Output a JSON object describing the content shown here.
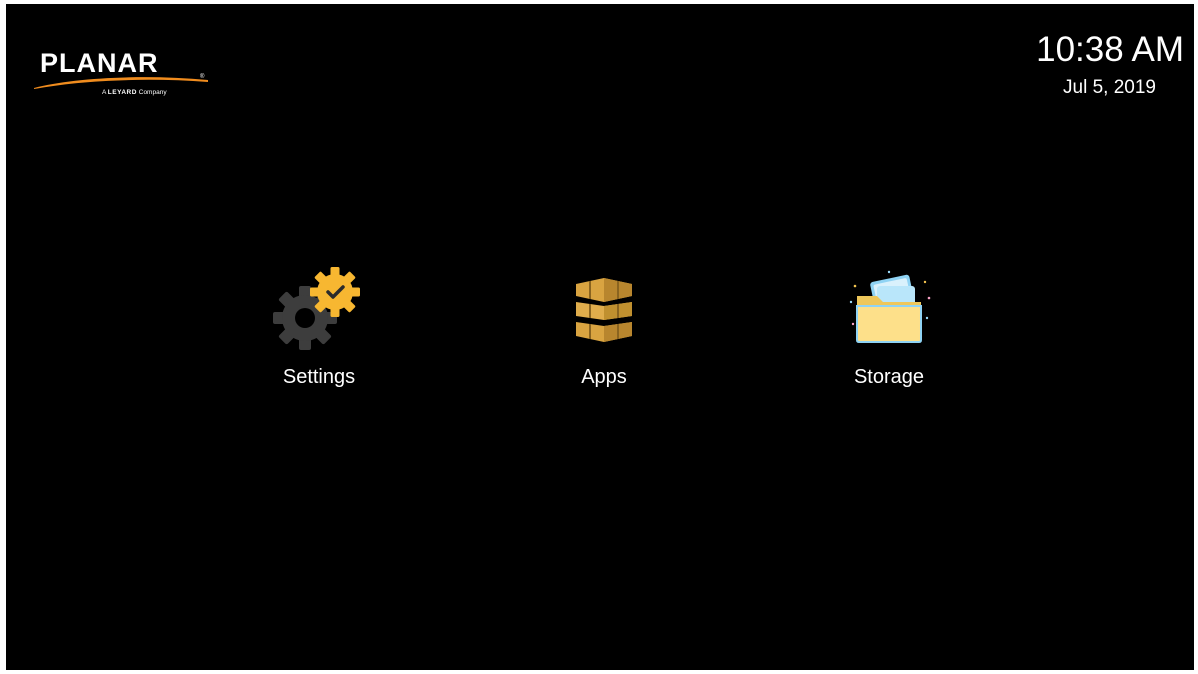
{
  "brand": {
    "name": "PLANAR",
    "registered_mark": "®",
    "tagline_prefix": "A",
    "tagline_brand": "LEYARD",
    "tagline_suffix": "Company"
  },
  "clock": {
    "time": "10:38 AM",
    "date": "Jul 5, 2019"
  },
  "launcher": {
    "items": [
      {
        "label": "Settings",
        "icon": "settings-gear-icon"
      },
      {
        "label": "Apps",
        "icon": "apps-box-icon"
      },
      {
        "label": "Storage",
        "icon": "storage-folder-icon"
      }
    ]
  },
  "colors": {
    "background": "#000000",
    "text": "#ffffff",
    "accent_orange": "#f08c1e",
    "gear_dark": "#3d3d3d",
    "gear_gold": "#f7b731",
    "apps_gold": "#d9a441",
    "folder_yellow": "#fde08a",
    "folder_blue": "#8fd3f4"
  }
}
